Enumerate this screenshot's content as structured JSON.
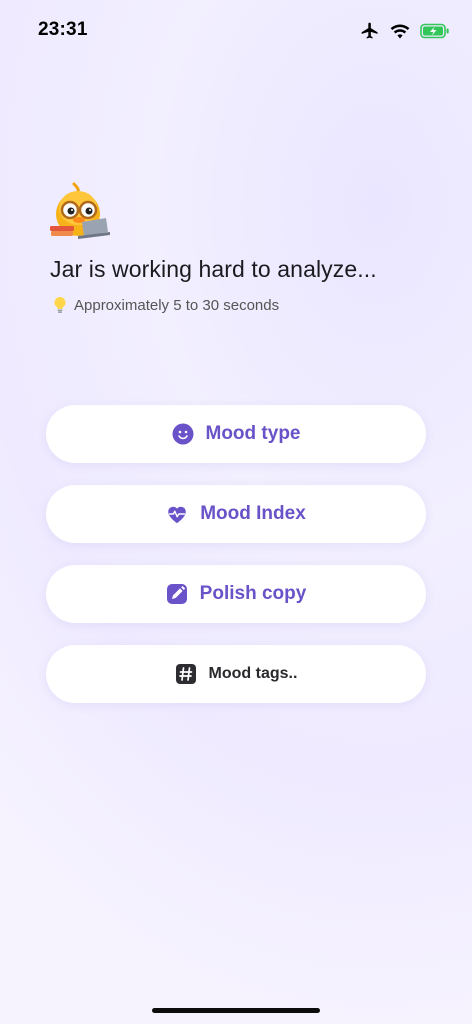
{
  "status_bar": {
    "time": "23:31",
    "icons": [
      "airplane-icon",
      "wifi-icon",
      "battery-charging-icon"
    ],
    "battery_color": "#33c759"
  },
  "header": {
    "mascot": "duck-with-glasses-laptop",
    "title": "Jar is working hard to analyze...",
    "subtitle": "Approximately 5 to 30 seconds",
    "subtitle_icon": "lightbulb-icon"
  },
  "tasks": [
    {
      "label": "Mood type",
      "icon": "smiley-face-icon"
    },
    {
      "label": "Mood Index",
      "icon": "heart-pulse-icon"
    },
    {
      "label": "Polish copy",
      "icon": "edit-pencil-icon"
    },
    {
      "label": "Mood tags..",
      "icon": "hashtag-icon"
    }
  ],
  "colors": {
    "accent": "#6a52c8",
    "muted_text": "#2a2a2e",
    "background": "#efeaff"
  }
}
